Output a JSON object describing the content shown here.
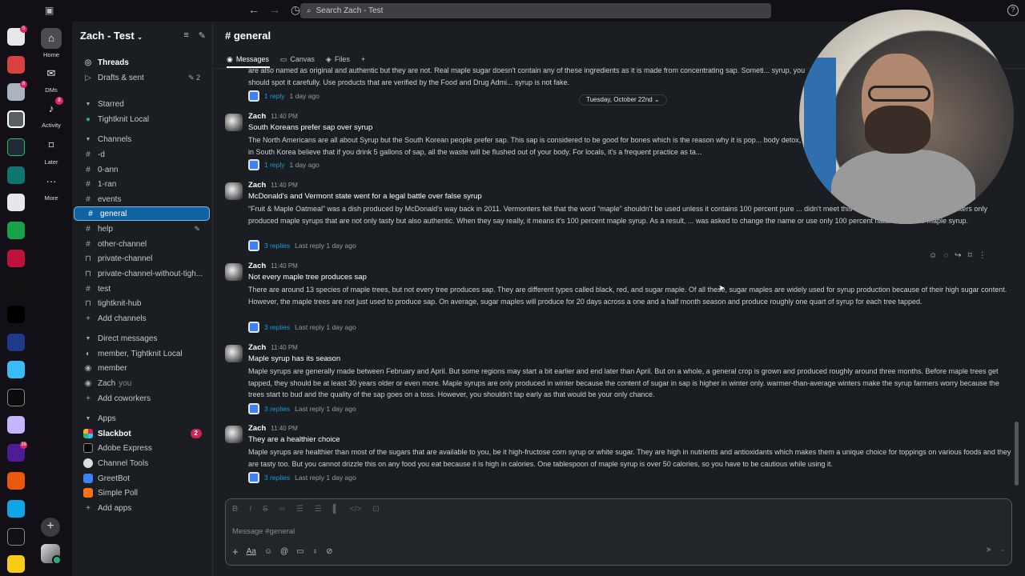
{
  "search": {
    "placeholder": "Search Zach - Test"
  },
  "workspace": {
    "name": "Zach - Test"
  },
  "nav": {
    "home": "Home",
    "dms": "DMs",
    "activity": "Activity",
    "activity_badge": "8",
    "later": "Later",
    "more": "More"
  },
  "rail": {
    "badge_1": "5",
    "badge_2": "8",
    "badge_3": "38"
  },
  "sidebar": {
    "threads": "Threads",
    "drafts": "Drafts & sent",
    "drafts_count": "2",
    "starred": "Starred",
    "starred_items": [
      "Tightknit Local"
    ],
    "channels_header": "Channels",
    "channels": [
      "-d",
      "0-ann",
      "1-ran",
      "events",
      "general",
      "help",
      "other-channel",
      "private-channel",
      "private-channel-without-tigh...",
      "test",
      "tightknit-hub"
    ],
    "add_channels": "Add channels",
    "dm_header": "Direct messages",
    "dms": [
      "member, Tightknit Local",
      "member",
      "Zach"
    ],
    "you_label": "you",
    "add_coworkers": "Add coworkers",
    "apps_header": "Apps",
    "apps": [
      "Slackbot",
      "Adobe Express",
      "Channel Tools",
      "GreetBot",
      "Simple Poll"
    ],
    "slackbot_badge": "2",
    "add_apps": "Add apps"
  },
  "channel": {
    "title": "# general",
    "tabs": [
      "Messages",
      "Canvas",
      "Files"
    ],
    "date_divider": "Tuesday, October 22nd"
  },
  "messages": [
    {
      "partial_body": "are also named as original and authentic but they are not. Real maple sugar doesn't contain any of these ingredients as it is made from concentrating sap. Someti... syrup, you should spot it carefully. Use products that are verified by the Food and Drug Admi... syrup is not fake.",
      "replies": "1 reply",
      "last": "1 day ago"
    },
    {
      "author": "Zach",
      "time": "11:40 PM",
      "title": "South Koreans prefer sap over syrup",
      "body": "The North Americans are all about Syrup but the South Korean people prefer sap. This sap is considered to be good for bones which is the reason why it is pop... body detox, people in South Korea believe that if you drink 5 gallons of sap, all the waste will be flushed out of your body. For locals, it's a frequent practice as ta...",
      "replies": "1 reply",
      "last": "1 day ago"
    },
    {
      "author": "Zach",
      "time": "11:40 PM",
      "title": "McDonald's and Vermont state went for a legal battle over false syrup",
      "body": "“Fruit & Maple Oatmeal” was a dish produced by McDonald's way back in 2011. Vermonters felt that the word “maple” shouldn't be used unless it contains 100 percent pure ... didn't meet this criterion. Over the years, Vermonters only produced maple syrups that are not only tasty but also authentic. When they say really, it means it's 100 percent maple syrup. As a result, ... was asked to change the name or use only 100 percent natural and real maple syrup.",
      "replies": "3 replies",
      "last": "Last reply 1 day ago"
    },
    {
      "author": "Zach",
      "time": "11:40 PM",
      "title": "Not every maple tree produces sap",
      "body": "There are around 13 species of maple trees, but not every tree produces sap. They are different types called black, red, and sugar maple. Of all these, sugar maples are widely used for syrup production because of their high sugar content. However, the maple trees are not just used to produce sap. On average, sugar maples will produce for 20 days across a one and a half month season and produce roughly one quart of syrup for each tree tapped.",
      "replies": "3 replies",
      "last": "Last reply 1 day ago"
    },
    {
      "author": "Zach",
      "time": "11:40 PM",
      "title": "Maple syrup has its season",
      "body": "Maple syrups are generally made between February and April. But some regions may start a bit earlier and end later than April. But on a whole, a general crop is grown and produced roughly around three months. Before maple trees get tapped, they should be at least 30 years older or even more. Maple syrups are only produced in winter because the content of sugar in sap is higher in winter only. warmer-than-average winters make the syrup farmers worry because the trees start to bud and the quality of the sap goes on a toss. However, you shouldn't tap early as that would be your only chance.",
      "replies": "3 replies",
      "last": "Last reply 1 day ago"
    },
    {
      "author": "Zach",
      "time": "11:40 PM",
      "title": "They are a healthier choice",
      "body": "Maple syrups are healthier than most of the sugars that are available to you, be it high-fructose corn syrup or white sugar. They are high in nutrients and antioxidants which makes them a unique choice for toppings on various foods and they are tasty too. But you cannot drizzle this on any food you eat because it is high in calories. One tablespoon of maple syrup is over 50 calories, so you have to be cautious while using it.",
      "replies": "3 replies",
      "last": "Last reply 1 day ago"
    }
  ],
  "composer": {
    "placeholder": "Message #general"
  },
  "colors": {
    "selected": "#1164a3",
    "link": "#1d9bd1",
    "badge": "#cd2553",
    "online": "#2bac76"
  }
}
